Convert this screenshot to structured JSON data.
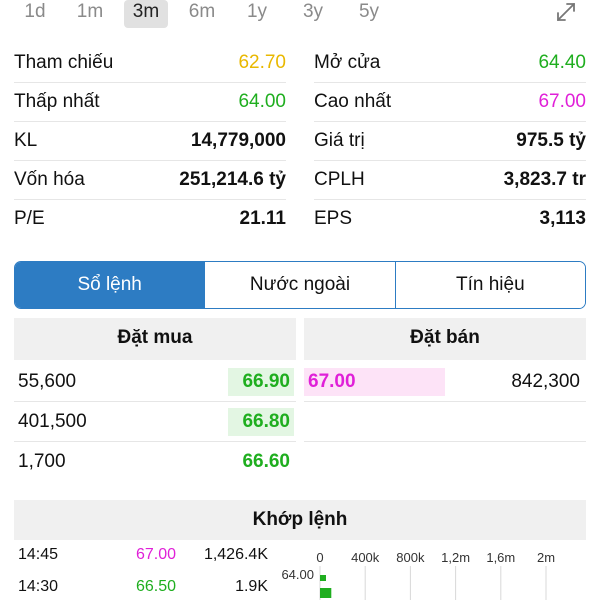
{
  "colors": {
    "reference": "#e9b800",
    "up": "#1fae1f",
    "ceiling": "#e020d8",
    "accent": "#2d7cc3"
  },
  "ranges": [
    "1d",
    "1m",
    "3m",
    "6m",
    "1y",
    "3y",
    "5y"
  ],
  "active_range": "3m",
  "stats": {
    "reference": {
      "label": "Tham chiếu",
      "value": "62.70"
    },
    "open": {
      "label": "Mở cửa",
      "value": "64.40"
    },
    "low": {
      "label": "Thấp nhất",
      "value": "64.00"
    },
    "high": {
      "label": "Cao nhất",
      "value": "67.00"
    },
    "volume": {
      "label": "KL",
      "value": "14,779,000"
    },
    "value": {
      "label": "Giá trị",
      "value": "975.5 tỷ"
    },
    "market_cap": {
      "label": "Vốn hóa",
      "value": "251,214.6 tỷ"
    },
    "shares": {
      "label": "CPLH",
      "value": "3,823.7 tr"
    },
    "pe": {
      "label": "P/E",
      "value": "21.11"
    },
    "eps": {
      "label": "EPS",
      "value": "3,113"
    }
  },
  "tabs": {
    "order_book": "Sổ lệnh",
    "foreign": "Nước ngoài",
    "signals": "Tín hiệu"
  },
  "order_book": {
    "buy_header": "Đặt mua",
    "sell_header": "Đặt bán",
    "bids": [
      {
        "qty": "55,600",
        "price": "66.90",
        "depth": 0.14
      },
      {
        "qty": "401,500",
        "price": "66.80",
        "depth": 1.0
      },
      {
        "qty": "1,700",
        "price": "66.60",
        "depth": 0.0
      }
    ],
    "asks": [
      {
        "qty": "842,300",
        "price": "67.00",
        "depth": 1.0
      }
    ]
  },
  "matched": {
    "header": "Khớp lệnh",
    "trades": [
      {
        "time": "14:45",
        "price": "67.00",
        "vol": "1,426.4K",
        "color": "ceiling"
      },
      {
        "time": "14:30",
        "price": "66.50",
        "vol": "1.9K",
        "color": "up"
      }
    ]
  },
  "chart_data": {
    "type": "bar",
    "orientation": "horizontal",
    "x_ticks": [
      "0",
      "400k",
      "800k",
      "1,2m",
      "1,6m",
      "2m"
    ],
    "x_tick_values": [
      0,
      400000,
      800000,
      1200000,
      1600000,
      2000000
    ],
    "categories": [
      "64.00"
    ],
    "values": [
      100000
    ],
    "xlim": [
      0,
      2000000
    ]
  }
}
